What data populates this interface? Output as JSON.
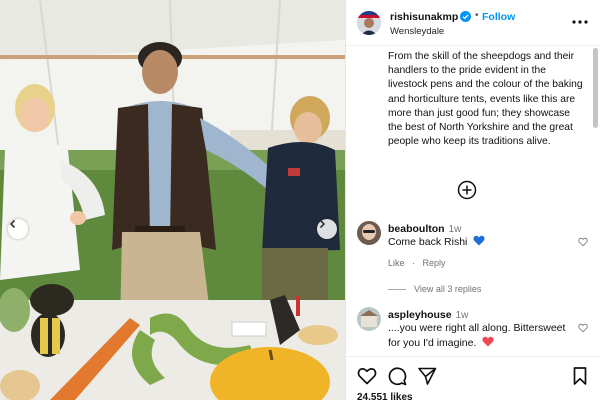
{
  "post": {
    "username": "rishisunakmp",
    "follow_label": "Follow",
    "separator": "•",
    "location": "Wensleydale",
    "caption": "From the skill of the sheepdogs and their handlers to the pride evident in the livestock pens and the colour of the baking and horticulture tents, events like this are more than just good fun; they showcase the best of North Yorkshire and the great people who keep its traditions alive.",
    "likes": "24,551 likes"
  },
  "comments": [
    {
      "username": "beaboulton",
      "time": "1w",
      "text": "Come back Rishi",
      "emoji": "blue-heart",
      "like_label": "Like",
      "reply_label": "Reply",
      "view_replies": "View all 3 replies"
    },
    {
      "username": "aspleyhouse",
      "time": "1w",
      "text": "....you were right all along. Bittersweet for you I'd imagine.",
      "emoji": "red-heart"
    }
  ],
  "icons": {
    "more": "more-options-icon",
    "verified": "verified-badge-icon",
    "load_more": "load-more-icon",
    "like": "heart-icon",
    "comment": "comment-icon",
    "share": "share-icon",
    "save": "bookmark-icon",
    "prev": "chevron-left-icon",
    "next": "chevron-right-icon"
  },
  "colors": {
    "accent": "#0095f6",
    "muted": "#737373",
    "red_heart": "#ed4956",
    "blue_heart": "#1e6fd9"
  }
}
